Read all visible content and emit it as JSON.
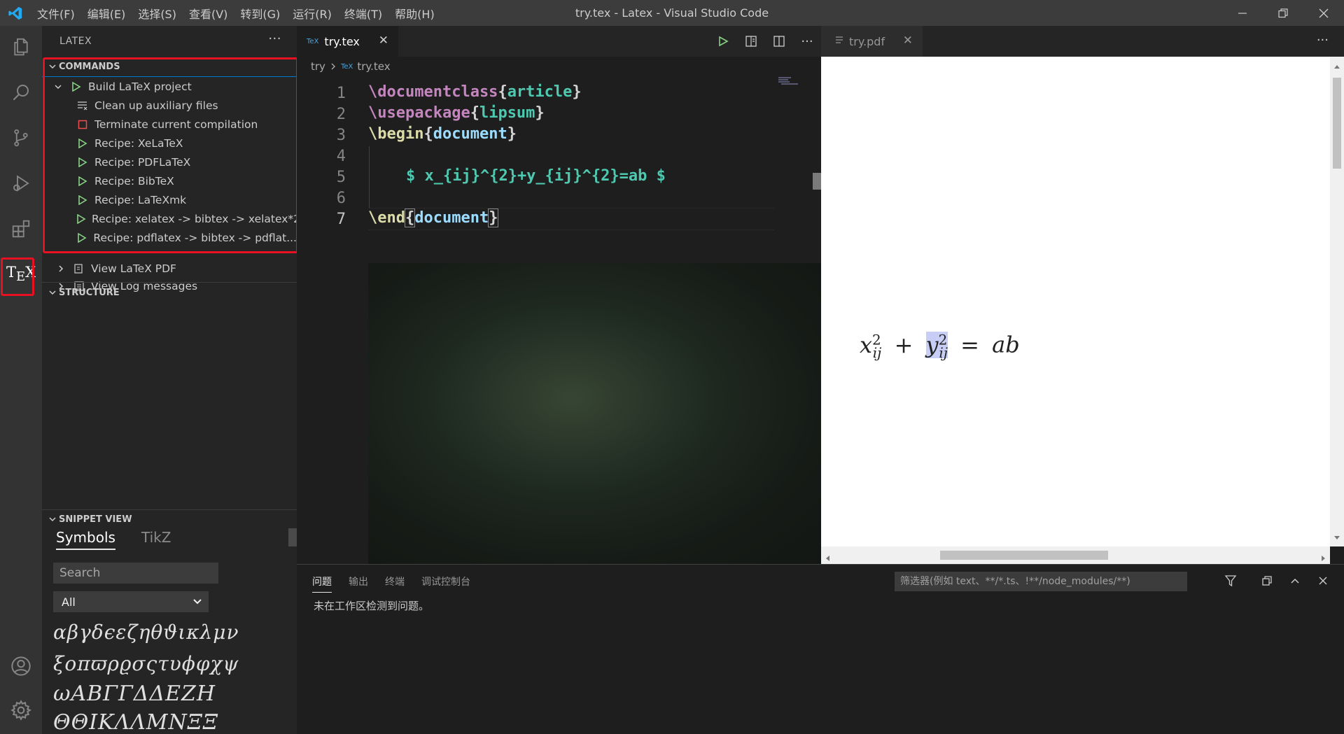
{
  "window": {
    "title": "try.tex - Latex - Visual Studio Code"
  },
  "menu": [
    "文件(F)",
    "编辑(E)",
    "选择(S)",
    "查看(V)",
    "转到(G)",
    "运行(R)",
    "终端(T)",
    "帮助(H)"
  ],
  "sidebar": {
    "title": "LATEX",
    "commands_header": "COMMANDS",
    "items": [
      "Build LaTeX project",
      "Clean up auxiliary files",
      "Terminate current compilation",
      "Recipe: XeLaTeX",
      "Recipe: PDFLaTeX",
      "Recipe: BibTeX",
      "Recipe: LaTeXmk",
      "Recipe: xelatex -> bibtex -> xelatex*2",
      "Recipe: pdflatex -> bibtex -> pdflat..."
    ],
    "view_pdf": "View LaTeX PDF",
    "view_log": "View Log messages",
    "structure_header": "STRUCTURE",
    "snippet_header": "SNIPPET VIEW",
    "snippet_tabs": [
      "Symbols",
      "TikZ"
    ],
    "search_placeholder": "Search",
    "filter_value": "All",
    "symbols": [
      "αβγδϵεζηθϑικλμν",
      "ξοπϖρϱσςτυϕφχψ",
      "ωΑΒΓΓΔΔΕΖΗ",
      "ΘΘΙΚΛΛΜΝΞΞ"
    ]
  },
  "editor": {
    "tab": "try.tex",
    "tab_icon": "TeX",
    "breadcrumb": [
      "try",
      "try.tex"
    ],
    "lines": [
      {
        "n": "1",
        "cmd": "\\documentclass",
        "arg": "article"
      },
      {
        "n": "2",
        "cmd": "\\usepackage",
        "arg": "lipsum"
      },
      {
        "n": "3",
        "cmd": "\\begin",
        "arg": "document"
      },
      {
        "n": "4"
      },
      {
        "n": "5",
        "math": "$ x_{ij}^{2}+y_{ij}^{2}=ab $"
      },
      {
        "n": "6"
      },
      {
        "n": "7",
        "cmd": "\\end",
        "arg": "document"
      }
    ]
  },
  "pdf": {
    "tab": "try.pdf"
  },
  "panel": {
    "tabs": [
      "问题",
      "输出",
      "终端",
      "调试控制台"
    ],
    "filter_placeholder": "筛选器(例如 text、**/*.ts、!**/node_modules/**)",
    "message": "未在工作区检测到问题。"
  },
  "colors": {
    "accent": "#007acc",
    "highlight_box": "#e81123",
    "play_green": "#89d185"
  }
}
